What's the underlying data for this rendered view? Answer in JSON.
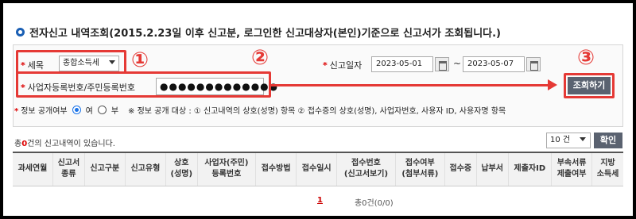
{
  "title": "전자신고 내역조회(2015.2.23일 이후 신고분, 로그인한  신고대상자(본인)기준으로  신고서가 조회됩니다.)",
  "form": {
    "tax_type_label": "세목",
    "tax_type_value": "종합소득세",
    "report_date_label": "신고일자",
    "date_from": "2023-05-01",
    "date_to": "2023-05-07",
    "date_sep": "~",
    "id_label": "사업자등록번호/주민등록번호",
    "id_value": "●●●●●●●●●●●●●",
    "disclosure_label": "정보 공개여부",
    "radio_yes": "여",
    "radio_no": "부",
    "disclosure_note": "※ 정보 공개 대상 : ① 신고내역의 상호(성명) 항목 ② 접수증의 상호(성명), 사업자번호, 사용자 ID, 사용자명 항목",
    "search_button": "조회하기"
  },
  "markers": {
    "one": "①",
    "two": "②",
    "three": "③"
  },
  "results": {
    "count_prefix": "총",
    "count": "0",
    "count_suffix": "건의 신고내역이 있습니다.",
    "page_size": "10 건",
    "confirm_button": "확인"
  },
  "table": {
    "headers": [
      [
        "과세연월",
        ""
      ],
      [
        "신고서",
        "종류"
      ],
      [
        "신고구분",
        ""
      ],
      [
        "신고유형",
        ""
      ],
      [
        "상호",
        "(성명)"
      ],
      [
        "사업자(주민)",
        "등록번호"
      ],
      [
        "접수방법",
        ""
      ],
      [
        "접수일시",
        ""
      ],
      [
        "접수번호",
        "(신고서보기)"
      ],
      [
        "접수여부",
        "(첨부서류)"
      ],
      [
        "접수증",
        ""
      ],
      [
        "납부서",
        ""
      ],
      [
        "제출자ID",
        ""
      ],
      [
        "부속서류",
        "제출여부"
      ],
      [
        "지방",
        "소득세"
      ]
    ]
  },
  "pager": {
    "current": "1",
    "summary": "총0건(0/0)"
  },
  "colors": {
    "accent_red": "#e53935",
    "button_gray": "#5a6270",
    "link_blue": "#1a5fb4"
  }
}
